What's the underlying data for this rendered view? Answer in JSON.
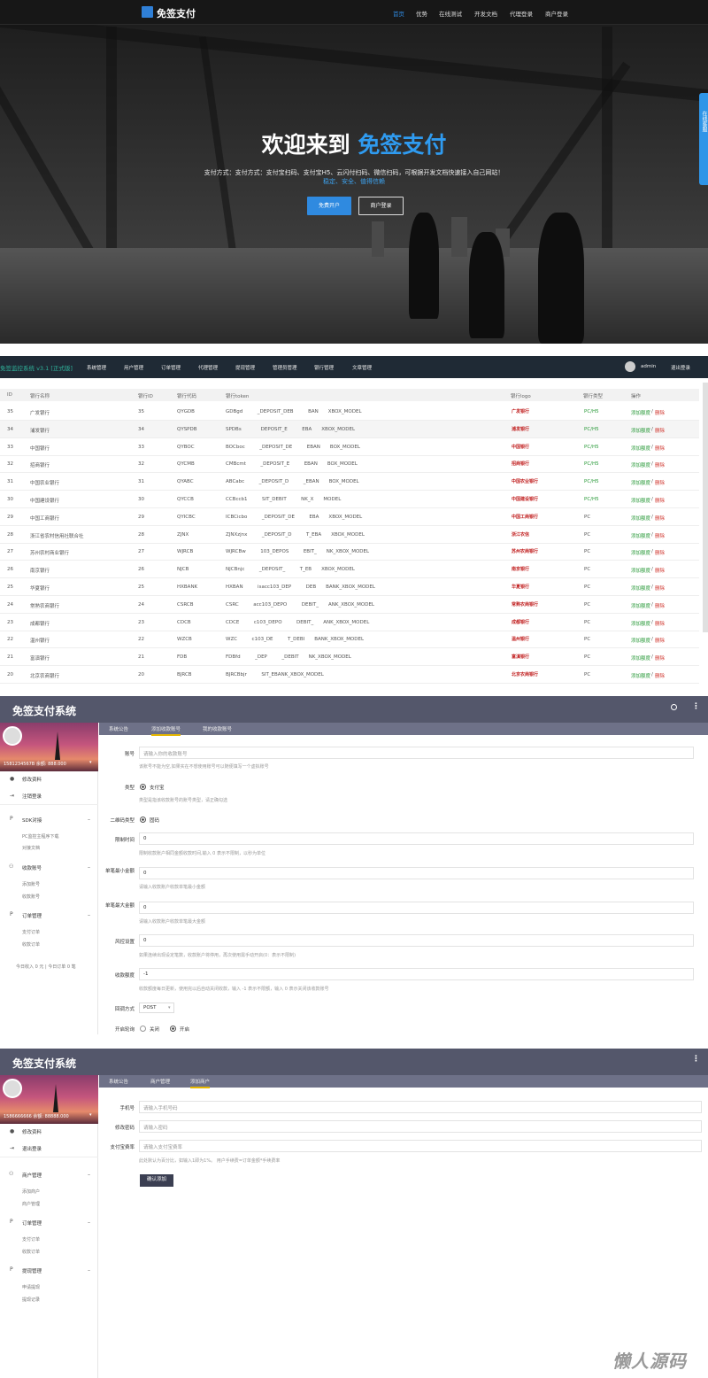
{
  "landing": {
    "brand": "免签支付",
    "nav": [
      "首页",
      "优势",
      "在线测试",
      "开发文档",
      "代理登录",
      "商户登录"
    ],
    "headline_a": "欢迎来到",
    "headline_b": "免签支付",
    "subtitle": "支付方式：支付宝扫码、支付宝H5、云闪付扫码、微信扫码，可根据开发文档快速接入自己网站！",
    "subtitle2": "稳定、安全、值得信赖",
    "btn_register": "免费开户",
    "btn_login": "商户登录",
    "float_label": "在线客服",
    "accent": "#2f8ae0"
  },
  "bank": {
    "title": "免签监控系统 v3.1 [正式版]",
    "menu": [
      "系统管理",
      "用户管理",
      "订单管理",
      "代理管理",
      "提现管理",
      "管理员管理",
      "银行管理",
      "文章管理"
    ],
    "user": "admin",
    "logout": "退出登录",
    "headers": [
      "ID",
      "银行名称",
      "银行ID",
      "银行代码",
      "银行token",
      "银行logo",
      "银行类型",
      "操作"
    ],
    "add_label": "添加额度",
    "del_label": "删除",
    "rows": [
      {
        "id": "35",
        "name": "广发银行",
        "bid": "35",
        "code": "QYGDB",
        "token": "GDBgd   _DEPOSIT_DEB   BAN  XBOX_MODEL",
        "logo": "广发银行",
        "type": "PC/H5"
      },
      {
        "id": "34",
        "name": "浦发银行",
        "bid": "34",
        "code": "QYSPDB",
        "token": "SPDBs    DEPOSIT_E   EBA  XBOX_MODEL",
        "logo": "浦发银行",
        "type": "PC/H5"
      },
      {
        "id": "33",
        "name": "中国银行",
        "bid": "33",
        "code": "QYBOC",
        "token": "BOCboc   _DEPOSIT_DE   EBAN  BOX_MODEL",
        "logo": "中国银行",
        "type": "PC/H5"
      },
      {
        "id": "32",
        "name": "招商银行",
        "bid": "32",
        "code": "QYCMB",
        "token": "CMBcmt   _DEPOSIT_E   EBAN  BOX_MODEL",
        "logo": "招商银行",
        "type": "PC/H5"
      },
      {
        "id": "31",
        "name": "中国农业银行",
        "bid": "31",
        "code": "QYABC",
        "token": "ABCabc   _DEPOSIT_D   _EBAN  BOX_MODEL",
        "logo": "中国农业银行",
        "type": "PC/H5"
      },
      {
        "id": "30",
        "name": "中国建设银行",
        "bid": "30",
        "code": "QYCCB",
        "token": "CCBccb1   SIT_DEBIT   NK_X  MODEL",
        "logo": "中国建设银行",
        "type": "PC/H5"
      },
      {
        "id": "29",
        "name": "中国工商银行",
        "bid": "29",
        "code": "QYICBC",
        "token": "ICBCicbo   _DEPOSIT_DE   EBA  XBOX_MODEL",
        "logo": "中国工商银行",
        "type": "PC"
      },
      {
        "id": "28",
        "name": "浙江省农村信用社联合社",
        "bid": "28",
        "code": "ZJNX",
        "token": "ZJNXzjnx   _DEPOSIT_D   T_EBA  XBOX_MODEL",
        "logo": "浙江农信",
        "type": "PC"
      },
      {
        "id": "27",
        "name": "苏州农村商业银行",
        "bid": "27",
        "code": "WJRCB",
        "token": "WJRCBw   103_DEPOS   EBIT_  NK_XBOX_MODEL",
        "logo": "苏州农商银行",
        "type": "PC"
      },
      {
        "id": "26",
        "name": "南京银行",
        "bid": "26",
        "code": "NJCB",
        "token": "NJCBnjc   _DEPOSIT_   T_EB  XBOX_MODEL",
        "logo": "南京银行",
        "type": "PC"
      },
      {
        "id": "25",
        "name": "华夏银行",
        "bid": "25",
        "code": "HXBANK",
        "token": "HXBAN   isacc103_DEP   DEB  BANK_XBOX_MODEL",
        "logo": "华夏银行",
        "type": "PC"
      },
      {
        "id": "24",
        "name": "常熟农商银行",
        "bid": "24",
        "code": "CSRCB",
        "token": "CSRC   acc103_DEPO   DEBIT_  ANK_XBOX_MODEL",
        "logo": "常熟农商银行",
        "type": "PC"
      },
      {
        "id": "23",
        "name": "成都银行",
        "bid": "23",
        "code": "CDCB",
        "token": "CDCE   c103_DEPO   DEBIT_  ANK_XBOX_MODEL",
        "logo": "成都银行",
        "type": "PC"
      },
      {
        "id": "22",
        "name": "温州银行",
        "bid": "22",
        "code": "WZCB",
        "token": "WZC   c103_DE   T_DEBI  BANK_XBOX_MODEL",
        "logo": "温州银行",
        "type": "PC"
      },
      {
        "id": "21",
        "name": "富滇银行",
        "bid": "21",
        "code": "FDB",
        "token": "FDBfd   _DEP   _DEBIT  NK_XBOX_MODEL",
        "logo": "富滇银行",
        "type": "PC"
      },
      {
        "id": "20",
        "name": "北京农商银行",
        "bid": "20",
        "code": "BJRCB",
        "token": "BJRCBbjr   SIT_EBANK_XBOX_MODEL",
        "logo": "北京农商银行",
        "type": "PC"
      }
    ]
  },
  "payment": {
    "title": "免签支付系统",
    "tabs": [
      "系统公告",
      "添加收款账号",
      "我的收款账号"
    ],
    "account_line": "1581234567B 余额: 888.000",
    "side": {
      "profile": "修改资料",
      "logout": "注销登录",
      "sdk": "SDK对接",
      "sdk_sub": [
        "PC监控主程序下载",
        "对接文档"
      ],
      "accounts": "收款账号",
      "accounts_sub": [
        "添加账号",
        "收款账号"
      ],
      "orders": "订单管理",
      "orders_sub": [
        "支付订单",
        "收款订单"
      ],
      "footer": "今日收入 0 元 | 今日订单 0 笔"
    },
    "form": {
      "account_label": "账号",
      "account_ph": "请输入你的收款账号",
      "account_hint": "该账号不能为空,如果实在不想使用账号可以随便填写一个虚拟账号",
      "type_label": "类型",
      "type_opt": "支付宝",
      "type_hint": "类型是指该收款账号的账号类型，请正确勾选",
      "qr_label": "二维码类型",
      "qr_opt": "固码",
      "limit_label": "限制时间",
      "limit_val": "0",
      "limit_hint": "限制收款账户相同金额收款时间,输入 0 表示不限制，以秒为单位",
      "min_label": "单笔最小金额",
      "min_val": "0",
      "min_hint": "请输入收款账户收款单笔最小金额",
      "max_label": "单笔最大金额",
      "max_val": "0",
      "max_hint": "请输入收款账户收款单笔最大金额",
      "risk_label": "风控设置",
      "risk_val": "0",
      "risk_hint": "如果连续出现设定笔数，收款账户将停用，再次使用需手动开启(0：表示不限制)",
      "quota_label": "收款额度",
      "quota_val": "-1",
      "quota_hint": "收款额度每日更新，使用完以后自动关闭收款，输入 -1 表示不限额，输入 0 表示关闭该收款账号",
      "cb_label": "回调方式",
      "cb_val": "POST",
      "open_label": "开启轮询",
      "off": "关闭",
      "on": "开启"
    }
  },
  "merchant": {
    "title": "免签支付系统",
    "tabs": [
      "系统公告",
      "商户管理",
      "添加商户"
    ],
    "account_line": "1586666666 余额: 88888.000",
    "side": {
      "profile": "修改资料",
      "logout": "退出登录",
      "merchants": "商户管理",
      "merchants_sub": [
        "添加商户",
        "商户管理"
      ],
      "orders": "订单管理",
      "orders_sub": [
        "支付订单",
        "收款订单"
      ],
      "withdraw": "提现管理",
      "withdraw_sub": [
        "申请提现",
        "提现记录"
      ]
    },
    "form": {
      "phone_label": "手机号",
      "phone_ph": "请输入手机号码",
      "pwd_label": "修改密码",
      "pwd_ph": "请输入密码",
      "rate_label": "支付宝费率",
      "rate_ph": "请输入支付宝费率",
      "rate_hint": "此处默认为百分比，如输入1即为1%。 用户手续费=订单金额*手续费率",
      "submit": "确认添加"
    }
  },
  "watermark": "懒人源码"
}
